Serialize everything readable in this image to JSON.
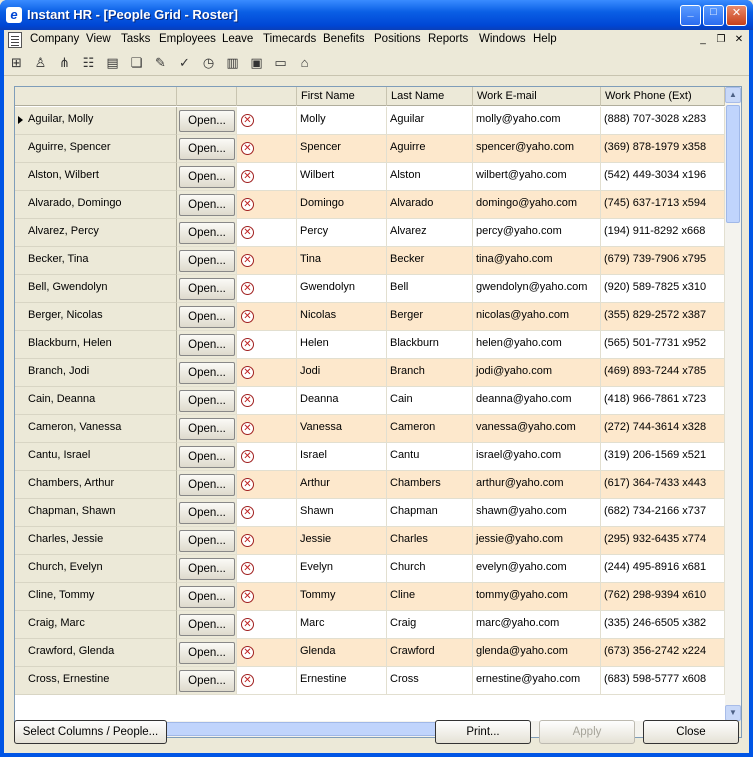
{
  "window": {
    "title": "Instant HR - [People Grid - Roster]",
    "minimize": "_",
    "maximize": "□",
    "close": "✕"
  },
  "menu": [
    "Company",
    "View",
    "Tasks",
    "Employees",
    "Leave",
    "Timecards",
    "Benefits",
    "Positions",
    "Reports",
    "Windows",
    "Help"
  ],
  "mdi": {
    "minimize": "_",
    "restore": "❐",
    "close": "✕"
  },
  "toolbar": [
    "org-chart-icon",
    "people-search-icon",
    "hierarchy-icon",
    "group-icon",
    "card-icon",
    "cards-icon",
    "leave-icon",
    "checklist-icon",
    "clock-icon",
    "document-icon",
    "new-folder-icon",
    "open-folder-icon",
    "tag-icon"
  ],
  "grid": {
    "columns": [
      "",
      "",
      "",
      "First Name",
      "Last Name",
      "Work E-mail",
      "Work Phone (Ext)"
    ],
    "open_label": "Open...",
    "rows": [
      {
        "name": "Aguilar, Molly",
        "first": "Molly",
        "last": "Aguilar",
        "email": "molly@yaho.com",
        "phone": "(888) 707-3028 x283"
      },
      {
        "name": "Aguirre, Spencer",
        "first": "Spencer",
        "last": "Aguirre",
        "email": "spencer@yaho.com",
        "phone": "(369) 878-1979 x358"
      },
      {
        "name": "Alston, Wilbert",
        "first": "Wilbert",
        "last": "Alston",
        "email": "wilbert@yaho.com",
        "phone": "(542) 449-3034 x196"
      },
      {
        "name": "Alvarado, Domingo",
        "first": "Domingo",
        "last": "Alvarado",
        "email": "domingo@yaho.com",
        "phone": "(745) 637-1713 x594"
      },
      {
        "name": "Alvarez, Percy",
        "first": "Percy",
        "last": "Alvarez",
        "email": "percy@yaho.com",
        "phone": "(194) 911-8292 x668"
      },
      {
        "name": "Becker, Tina",
        "first": "Tina",
        "last": "Becker",
        "email": "tina@yaho.com",
        "phone": "(679) 739-7906 x795"
      },
      {
        "name": "Bell, Gwendolyn",
        "first": "Gwendolyn",
        "last": "Bell",
        "email": "gwendolyn@yaho.com",
        "phone": "(920) 589-7825 x310"
      },
      {
        "name": "Berger, Nicolas",
        "first": "Nicolas",
        "last": "Berger",
        "email": "nicolas@yaho.com",
        "phone": "(355) 829-2572 x387"
      },
      {
        "name": "Blackburn, Helen",
        "first": "Helen",
        "last": "Blackburn",
        "email": "helen@yaho.com",
        "phone": "(565) 501-7731 x952"
      },
      {
        "name": "Branch, Jodi",
        "first": "Jodi",
        "last": "Branch",
        "email": "jodi@yaho.com",
        "phone": "(469) 893-7244 x785"
      },
      {
        "name": "Cain, Deanna",
        "first": "Deanna",
        "last": "Cain",
        "email": "deanna@yaho.com",
        "phone": "(418) 966-7861 x723"
      },
      {
        "name": "Cameron, Vanessa",
        "first": "Vanessa",
        "last": "Cameron",
        "email": "vanessa@yaho.com",
        "phone": "(272) 744-3614 x328"
      },
      {
        "name": "Cantu, Israel",
        "first": "Israel",
        "last": "Cantu",
        "email": "israel@yaho.com",
        "phone": "(319) 206-1569 x521"
      },
      {
        "name": "Chambers, Arthur",
        "first": "Arthur",
        "last": "Chambers",
        "email": "arthur@yaho.com",
        "phone": "(617) 364-7433 x443"
      },
      {
        "name": "Chapman, Shawn",
        "first": "Shawn",
        "last": "Chapman",
        "email": "shawn@yaho.com",
        "phone": "(682) 734-2166 x737"
      },
      {
        "name": "Charles, Jessie",
        "first": "Jessie",
        "last": "Charles",
        "email": "jessie@yaho.com",
        "phone": "(295) 932-6435 x774"
      },
      {
        "name": "Church, Evelyn",
        "first": "Evelyn",
        "last": "Church",
        "email": "evelyn@yaho.com",
        "phone": "(244) 495-8916 x681"
      },
      {
        "name": "Cline, Tommy",
        "first": "Tommy",
        "last": "Cline",
        "email": "tommy@yaho.com",
        "phone": "(762) 298-9394 x610"
      },
      {
        "name": "Craig, Marc",
        "first": "Marc",
        "last": "Craig",
        "email": "marc@yaho.com",
        "phone": "(335) 246-6505 x382"
      },
      {
        "name": "Crawford, Glenda",
        "first": "Glenda",
        "last": "Crawford",
        "email": "glenda@yaho.com",
        "phone": "(673) 356-2742 x224"
      },
      {
        "name": "Cross, Ernestine",
        "first": "Ernestine",
        "last": "Cross",
        "email": "ernestine@yaho.com",
        "phone": "(683) 598-5777 x608"
      }
    ]
  },
  "buttons": {
    "select": "Select Columns / People...",
    "print": "Print...",
    "apply": "Apply",
    "close": "Close"
  },
  "colors": {
    "alt_row": "#fde8cc",
    "title_blue": "#0055e5"
  }
}
